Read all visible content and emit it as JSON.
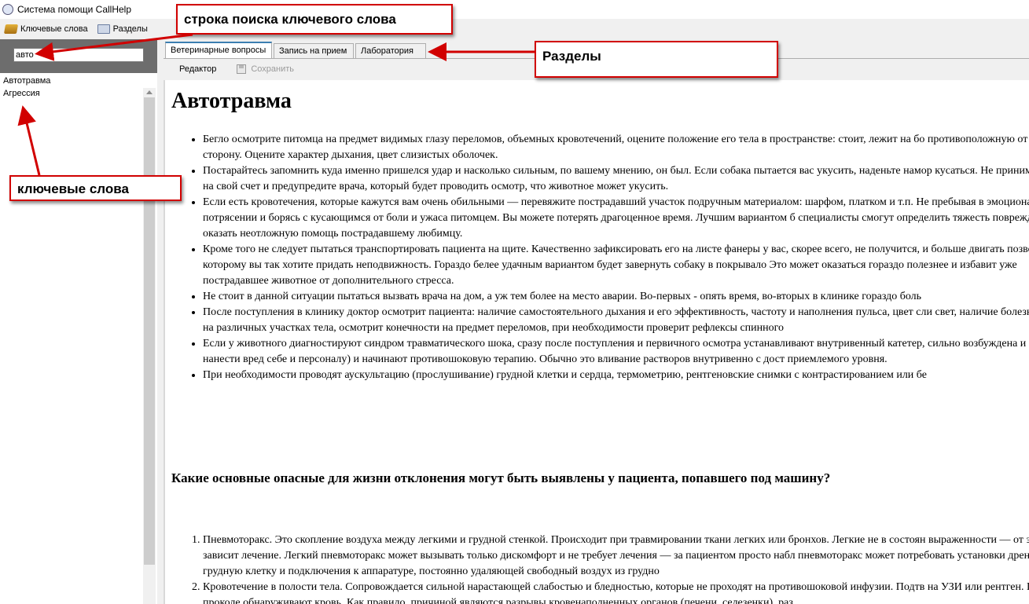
{
  "window": {
    "title": "Система помощи CallHelp"
  },
  "menu": {
    "items": [
      {
        "label": "Ключевые слова",
        "icon": "book-icon"
      },
      {
        "label": "Разделы",
        "icon": "sections-icon"
      }
    ]
  },
  "search": {
    "value": "авто"
  },
  "keywords": [
    "Автотравма",
    "Агрессия"
  ],
  "tabs": [
    {
      "label": "Ветеринарные вопросы",
      "active": true
    },
    {
      "label": "Запись на прием",
      "active": false
    },
    {
      "label": "Лаборатория",
      "active": false
    }
  ],
  "toolbar": {
    "editor_label": "Редактор",
    "save_label": "Сохранить"
  },
  "document": {
    "title": "Автотравма",
    "bullets": [
      "Бегло осмотрите питомца на предмет видимых глазу переломов, объемных кровотечений, оцените положение его тела в пространстве: стоит, лежит на бо противоположную от вас сторону. Оцените характер дыхания, цвет слизистых оболочек.",
      "Постарайтесь запомнить куда именно пришелся удар и насколько сильным, по вашему мнению, он был. Если собака пытается вас укусить, наденьте намор кусаться. Не принимайте это на свой счет и предупредите врача, который будет проводить осмотр, что животное может укусить.",
      "Если есть кровотечения, которые кажутся вам очень обильными — перевяжите пострадавший участок подручным материалом: шарфом, платком и т.п. Не пребывая в эмоциональном потрясении и борясь с кусающимся от боли и ужаса питомцем. Вы можете потерять драгоценное время. Лучшим вариантом б специалисты смогут определить тяжесть повреждений и оказать неотложную помощь пострадавшему любимцу.",
      "Кроме того не следует пытаться транспортировать пациента на щите. Качественно зафиксировать его на листе фанеры у вас, скорее всего, не получится, и больше двигать позвоночником, которому вы так хотите придать неподвижность. Гораздо белее удачным вариантом будет завернуть собаку в покрывало Это может оказаться гораздо полезнее и избавит уже пострадавшее животное от дополнительного стресса.",
      "Не стоит в данной ситуации пытаться вызвать врача на дом, а уж тем более на место аварии. Во-первых - опять время, во-вторых в клинике гораздо боль",
      "После поступления в клинику доктор осмотрит пациента: наличие самостоятельного дыхания и его эффективность, частоту и наполнения пульса, цвет сли свет, наличие болезненности на различных участках тела, осмотрит конечности на предмет переломов, при необходимости проверит рефлексы спинного",
      "Если у животного диагностируют синдром травматического шока, сразу после поступления и первичного осмотра устанавливают внутривенный катетер, сильно возбуждена и может нанести вред себе и персоналу) и начинают противошоковую терапию. Обычно это вливание растворов внутривенно с дост приемлемого уровня.",
      "При необходимости проводят аускультацию (прослушивание) грудной клетки и сердца, термометрию, рентгеновские снимки с контрастированием или бе"
    ],
    "heading2": "Какие основные опасные для жизни отклонения могут быть выявлены у пациента, попавшего под машину?",
    "numbered": [
      "Пневмоторакс. Это скопление воздуха между легкими и грудной стенкой. Происходит при травмировании ткани легких или бронхов. Легкие не в состоян выраженности — от этого зависит лечение. Легкий пневмоторакс может вызывать только дискомфорт и не требует лечения — за пациентом просто набл пневмоторакс может потребовать установки дренажей в грудную клетку и подключения к аппаратуре, постоянно удаляющей свободный воздух из грудно",
      "Кровотечение в полости тела. Сопровождается сильной нарастающей слабостью и бледностью, которые не проходят на противошоковой инфузии. Подтв на УЗИ или рентген. При проколе обнаруживают кровь. Как правило, причиной являются разрывы кровенаполненных органов (печени, селезенки), раз"
    ]
  },
  "annotations": {
    "search": "строка поиска ключевого слова",
    "sections": "Разделы",
    "keywords": "ключевые слова"
  },
  "colors": {
    "annotation_border": "#d10000",
    "tab_active_accent": "#3c7fb1",
    "search_bg": "#6d6d6d"
  }
}
